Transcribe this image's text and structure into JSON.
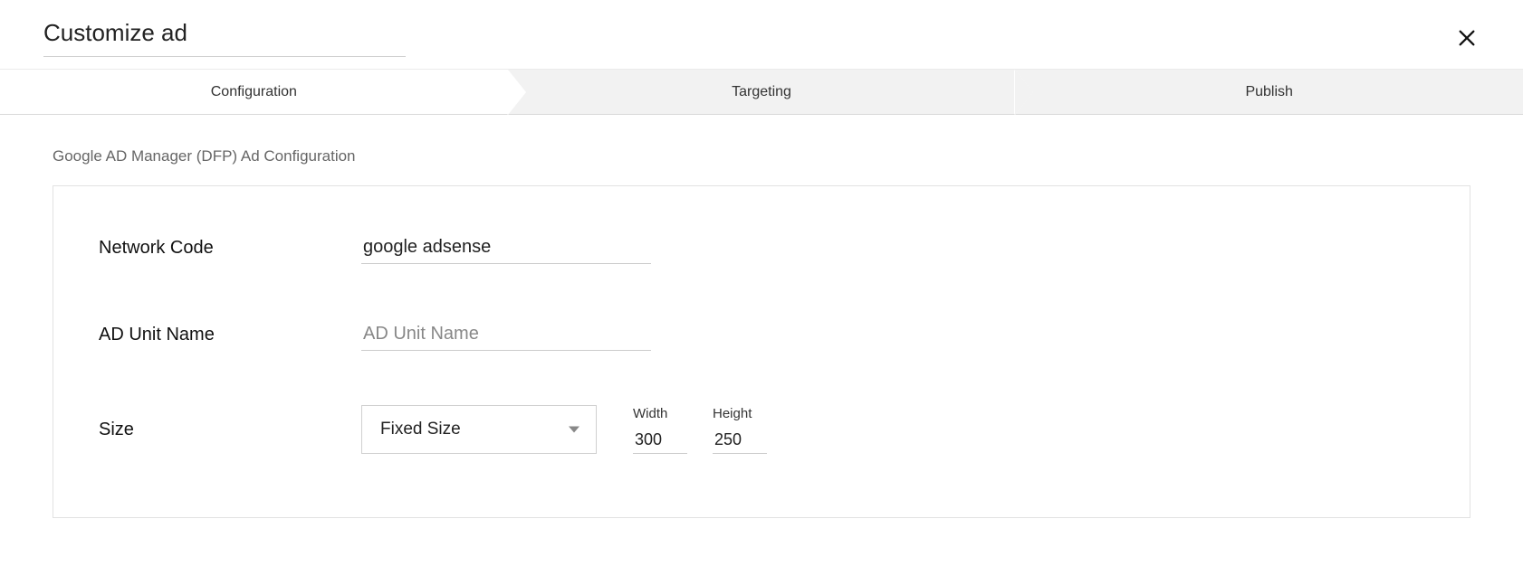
{
  "header": {
    "title": "Customize ad"
  },
  "steps": {
    "configuration": "Configuration",
    "targeting": "Targeting",
    "publish": "Publish"
  },
  "section": {
    "heading": "Google AD Manager (DFP) Ad Configuration"
  },
  "form": {
    "network_code": {
      "label": "Network Code",
      "value": "google adsense"
    },
    "ad_unit_name": {
      "label": "AD Unit Name",
      "value": "",
      "placeholder": "AD Unit Name"
    },
    "size": {
      "label": "Size",
      "selected": "Fixed Size",
      "width_label": "Width",
      "width_value": "300",
      "height_label": "Height",
      "height_value": "250"
    }
  }
}
